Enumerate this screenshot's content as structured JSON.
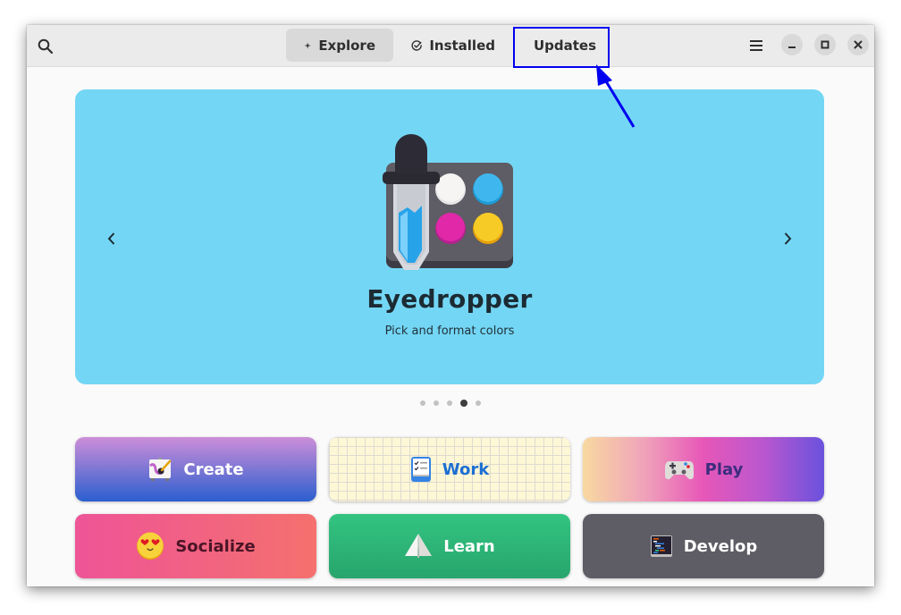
{
  "header": {
    "search_icon": "search-icon",
    "tabs": [
      {
        "label": "Explore",
        "icon": "sparkle-icon",
        "active": true
      },
      {
        "label": "Installed",
        "icon": "check-circle-icon",
        "active": false
      },
      {
        "label": "Updates",
        "icon": "refresh-icon",
        "active": false
      }
    ],
    "menu_icon": "hamburger-menu-icon",
    "window_controls": [
      "minimize",
      "maximize",
      "close"
    ]
  },
  "featured": {
    "app_name": "Eyedropper",
    "summary": "Pick and format colors",
    "background_color": "#74d6f5",
    "carousel": {
      "total": 5,
      "active_index": 4
    }
  },
  "categories": [
    {
      "label": "Create",
      "icon": "paint-easel-icon"
    },
    {
      "label": "Work",
      "icon": "checklist-icon"
    },
    {
      "label": "Play",
      "icon": "gamepad-icon"
    },
    {
      "label": "Socialize",
      "icon": "heart-eyes-emoji-icon"
    },
    {
      "label": "Learn",
      "icon": "paper-plane-icon"
    },
    {
      "label": "Develop",
      "icon": "code-editor-icon"
    }
  ],
  "annotation": {
    "target": "Updates",
    "color": "#0000f0"
  }
}
